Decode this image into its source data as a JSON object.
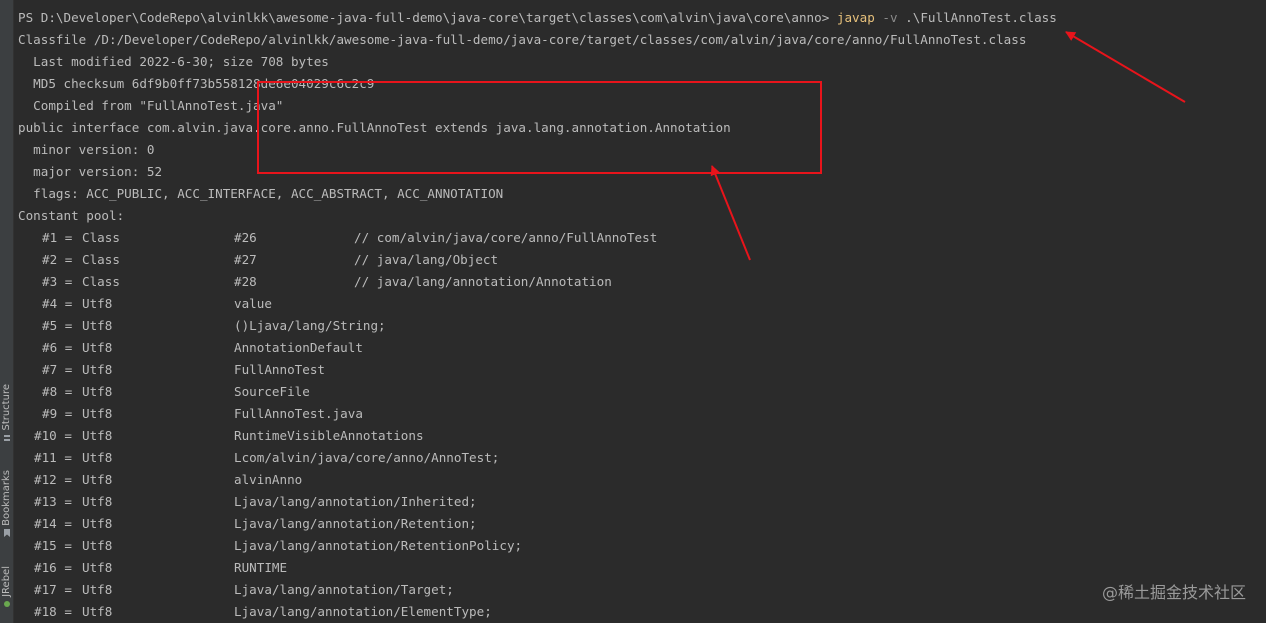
{
  "sidebar": {
    "tabs": [
      {
        "label": "Structure",
        "icon": "structure-icon"
      },
      {
        "label": "Bookmarks",
        "icon": "bookmark-icon"
      },
      {
        "label": "JRebel",
        "icon": "jrebel-icon"
      }
    ]
  },
  "terminal": {
    "prompt": "PS D:\\Developer\\CodeRepo\\alvinlkk\\awesome-java-full-demo\\java-core\\target\\classes\\com\\alvin\\java\\core\\anno>",
    "command": "javap",
    "flag": "-v",
    "arg": ".\\FullAnnoTest.class",
    "header_lines": [
      "Classfile /D:/Developer/CodeRepo/alvinlkk/awesome-java-full-demo/java-core/target/classes/com/alvin/java/core/anno/FullAnnoTest.class",
      "  Last modified 2022-6-30; size 708 bytes",
      "  MD5 checksum 6df9b0ff73b558128de6e04029c6c2c9",
      "  Compiled from \"FullAnnoTest.java\"",
      "public interface com.alvin.java.core.anno.FullAnnoTest extends java.lang.annotation.Annotation",
      "  minor version: 0",
      "  major version: 52",
      "  flags: ACC_PUBLIC, ACC_INTERFACE, ACC_ABSTRACT, ACC_ANNOTATION",
      "Constant pool:"
    ],
    "constant_pool": [
      {
        "idx": "#1 =",
        "type": "Class",
        "value": "#26",
        "comment": "// com/alvin/java/core/anno/FullAnnoTest"
      },
      {
        "idx": "#2 =",
        "type": "Class",
        "value": "#27",
        "comment": "// java/lang/Object"
      },
      {
        "idx": "#3 =",
        "type": "Class",
        "value": "#28",
        "comment": "// java/lang/annotation/Annotation"
      },
      {
        "idx": "#4 =",
        "type": "Utf8",
        "value": "value",
        "comment": ""
      },
      {
        "idx": "#5 =",
        "type": "Utf8",
        "value": "()Ljava/lang/String;",
        "comment": ""
      },
      {
        "idx": "#6 =",
        "type": "Utf8",
        "value": "AnnotationDefault",
        "comment": ""
      },
      {
        "idx": "#7 =",
        "type": "Utf8",
        "value": "FullAnnoTest",
        "comment": ""
      },
      {
        "idx": "#8 =",
        "type": "Utf8",
        "value": "SourceFile",
        "comment": ""
      },
      {
        "idx": "#9 =",
        "type": "Utf8",
        "value": "FullAnnoTest.java",
        "comment": ""
      },
      {
        "idx": "#10 =",
        "type": "Utf8",
        "value": "RuntimeVisibleAnnotations",
        "comment": ""
      },
      {
        "idx": "#11 =",
        "type": "Utf8",
        "value": "Lcom/alvin/java/core/anno/AnnoTest;",
        "comment": ""
      },
      {
        "idx": "#12 =",
        "type": "Utf8",
        "value": "alvinAnno",
        "comment": ""
      },
      {
        "idx": "#13 =",
        "type": "Utf8",
        "value": "Ljava/lang/annotation/Inherited;",
        "comment": ""
      },
      {
        "idx": "#14 =",
        "type": "Utf8",
        "value": "Ljava/lang/annotation/Retention;",
        "comment": ""
      },
      {
        "idx": "#15 =",
        "type": "Utf8",
        "value": "Ljava/lang/annotation/RetentionPolicy;",
        "comment": ""
      },
      {
        "idx": "#16 =",
        "type": "Utf8",
        "value": "RUNTIME",
        "comment": ""
      },
      {
        "idx": "#17 =",
        "type": "Utf8",
        "value": "Ljava/lang/annotation/Target;",
        "comment": ""
      },
      {
        "idx": "#18 =",
        "type": "Utf8",
        "value": "Ljava/lang/annotation/ElementType;",
        "comment": ""
      }
    ]
  },
  "watermark": "@稀土掘金技术社区",
  "colors": {
    "background": "#2b2b2b",
    "text": "#bbbbbb",
    "command": "#e6c07b",
    "annotation": "#e8141b"
  }
}
